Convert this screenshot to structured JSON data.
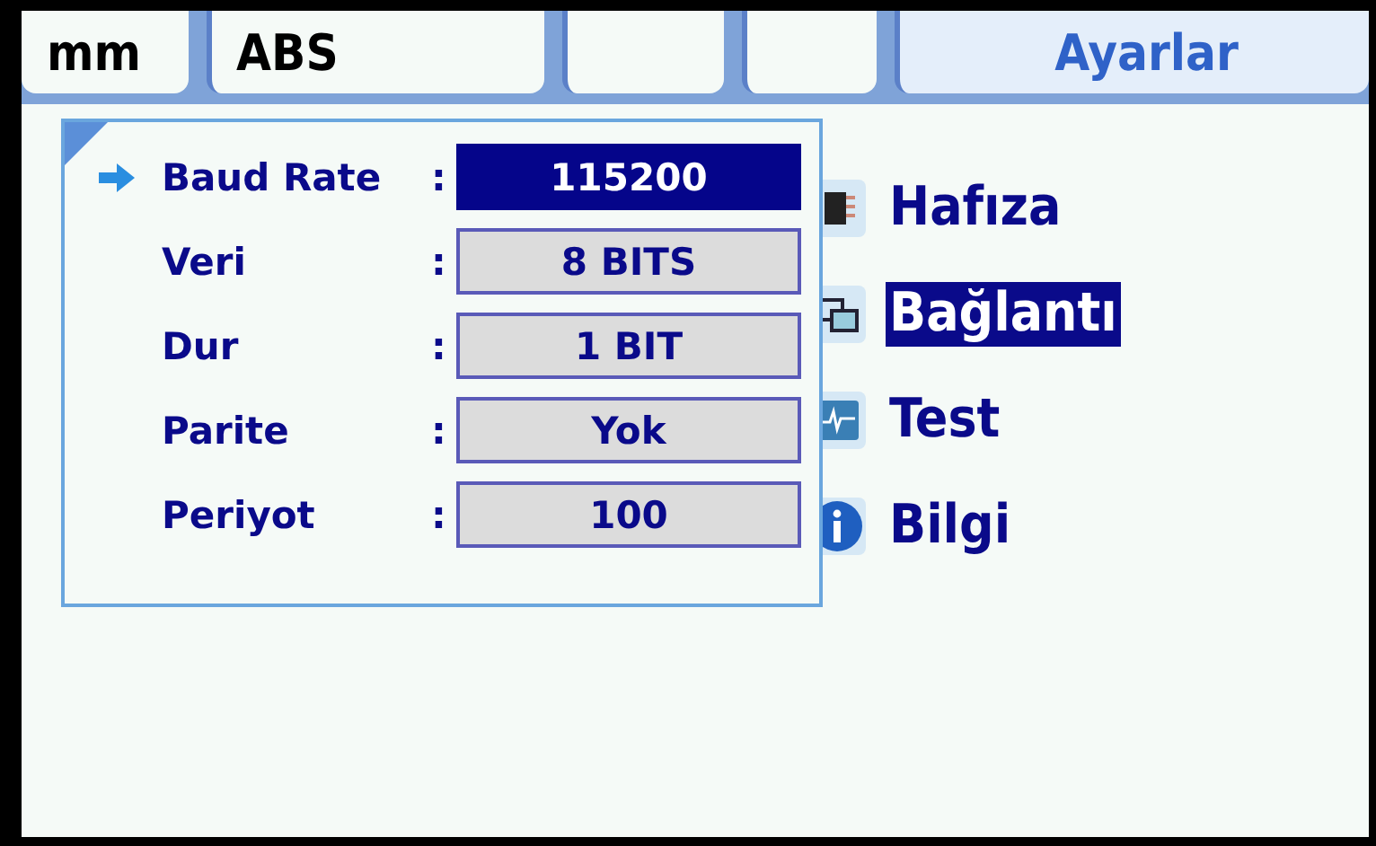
{
  "tabs": [
    {
      "kind": "text",
      "label": "mm",
      "selected": false
    },
    {
      "kind": "text",
      "label": "ABS",
      "selected": false
    },
    {
      "kind": "blank",
      "selected": false
    },
    {
      "kind": "blank",
      "selected": false
    },
    {
      "kind": "text",
      "label": "Ayarlar",
      "selected": true
    }
  ],
  "menu": [
    {
      "label": "Hafıza",
      "selected": false
    },
    {
      "label": "Bağlantı",
      "selected": true
    },
    {
      "label": "Test",
      "selected": false
    },
    {
      "label": "Bilgi",
      "selected": false
    }
  ],
  "dialog": {
    "rows": [
      {
        "label": "Baud Rate",
        "separator": ":",
        "value": "115200",
        "selected": true
      },
      {
        "label": "Veri",
        "separator": ":",
        "value": "8 BITS",
        "selected": false
      },
      {
        "label": "Dur",
        "separator": ":",
        "value": "1 BIT",
        "selected": false
      },
      {
        "label": "Parite",
        "separator": ":",
        "value": "Yok",
        "selected": false
      },
      {
        "label": "Periyot",
        "separator": ":",
        "value": "100",
        "selected": false
      }
    ]
  }
}
